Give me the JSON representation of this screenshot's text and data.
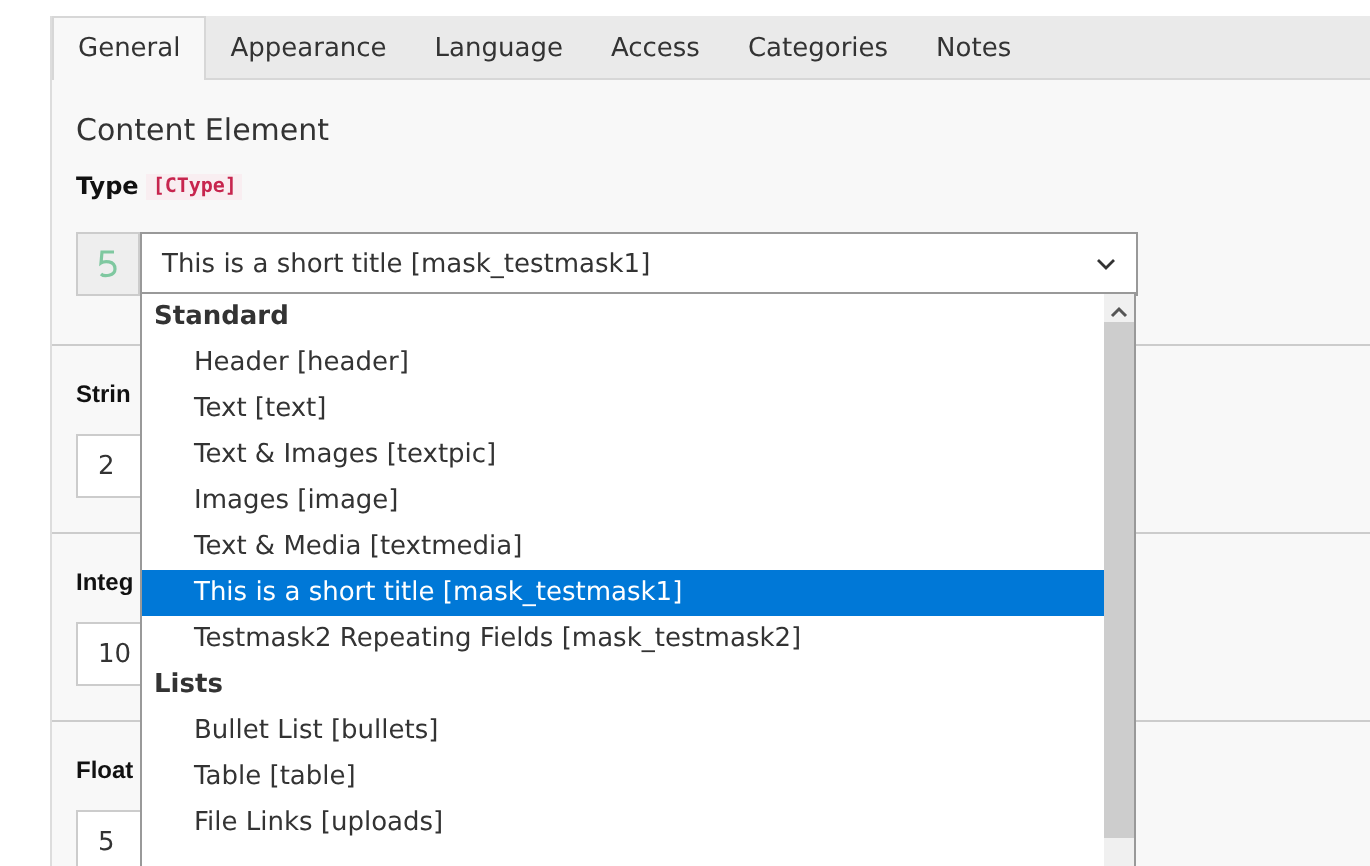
{
  "tabs": [
    {
      "label": "General",
      "selected": true
    },
    {
      "label": "Appearance",
      "selected": false
    },
    {
      "label": "Language",
      "selected": false
    },
    {
      "label": "Access",
      "selected": false
    },
    {
      "label": "Categories",
      "selected": false
    },
    {
      "label": "Notes",
      "selected": false
    }
  ],
  "section_title": "Content Element",
  "type_field": {
    "label": "Type",
    "field_name": "[CType]",
    "value": "This is a short title [mask_testmask1]",
    "expanded": true
  },
  "dropdown": [
    {
      "kind": "group",
      "label": "Standard"
    },
    {
      "kind": "option",
      "label": "Header [header]",
      "selected": false
    },
    {
      "kind": "option",
      "label": "Text [text]",
      "selected": false
    },
    {
      "kind": "option",
      "label": "Text & Images [textpic]",
      "selected": false
    },
    {
      "kind": "option",
      "label": "Images [image]",
      "selected": false
    },
    {
      "kind": "option",
      "label": "Text & Media [textmedia]",
      "selected": false
    },
    {
      "kind": "option",
      "label": "This is a short title [mask_testmask1]",
      "selected": true
    },
    {
      "kind": "option",
      "label": "Testmask2 Repeating Fields [mask_testmask2]",
      "selected": false
    },
    {
      "kind": "group",
      "label": "Lists"
    },
    {
      "kind": "option",
      "label": "Bullet List [bullets]",
      "selected": false
    },
    {
      "kind": "option",
      "label": "Table [table]",
      "selected": false
    },
    {
      "kind": "option",
      "label": "File Links [uploads]",
      "selected": false
    }
  ],
  "fields": [
    {
      "label": "Strin",
      "value": "2"
    },
    {
      "label": "Integ",
      "value": "10"
    },
    {
      "label": "Float",
      "value": "5"
    }
  ]
}
